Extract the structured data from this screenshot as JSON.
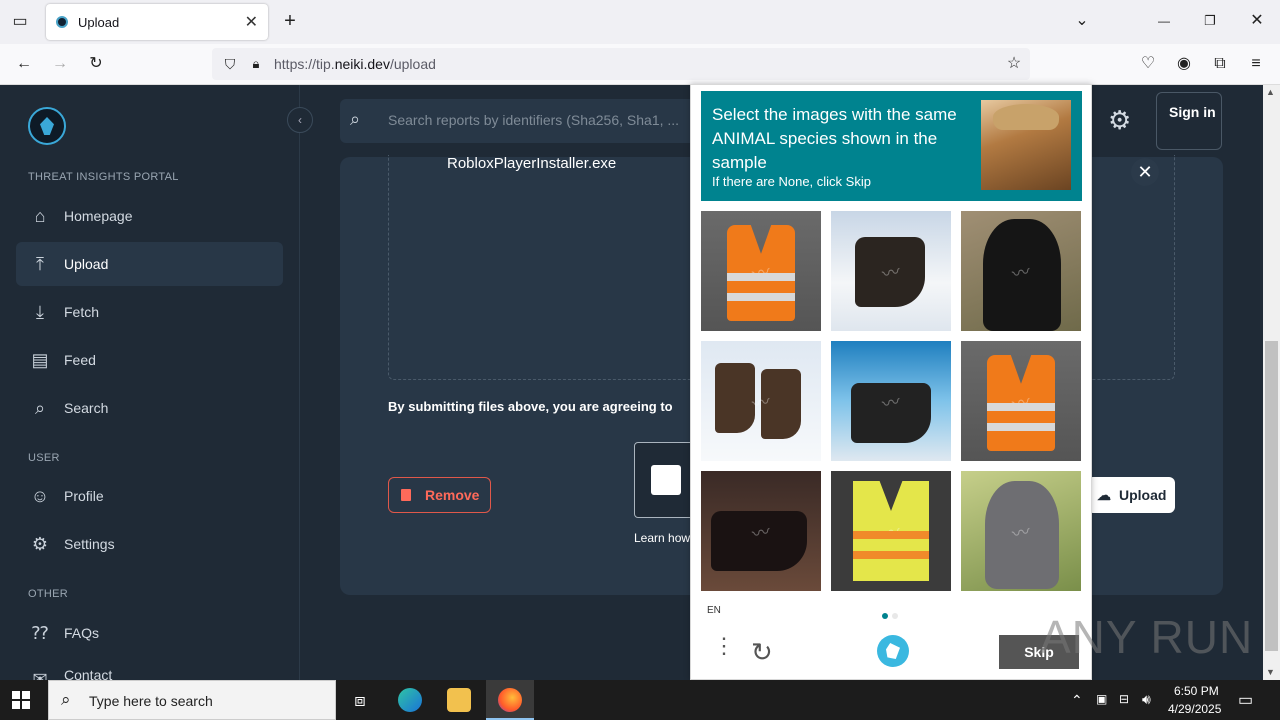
{
  "browser": {
    "tab_title": "Upload",
    "tab_close": "✕",
    "new_tab": "+",
    "url_prefix": "https://tip.",
    "url_domain": "neiki.dev",
    "url_path": "/upload",
    "window_controls": [
      "—",
      "❐",
      "✕"
    ]
  },
  "sidebar": {
    "section_portal": "THREAT INSIGHTS PORTAL",
    "items": [
      {
        "label": "Homepage",
        "icon": "home-icon"
      },
      {
        "label": "Upload",
        "icon": "upload-icon",
        "active": true
      },
      {
        "label": "Fetch",
        "icon": "fetch-icon"
      },
      {
        "label": "Feed",
        "icon": "feed-icon"
      },
      {
        "label": "Search",
        "icon": "search-icon"
      }
    ],
    "section_user": "USER",
    "user_items": [
      {
        "label": "Profile",
        "icon": "profile-icon"
      },
      {
        "label": "Settings",
        "icon": "gear-icon"
      }
    ],
    "section_other": "OTHER",
    "other_items": [
      {
        "label": "FAQs",
        "icon": "faq-icon"
      },
      {
        "label": "Contact",
        "icon": "contact-icon"
      }
    ]
  },
  "header": {
    "search_placeholder": "Search reports by identifiers (Sha256, Sha1, ...",
    "sign_in": "Sign in"
  },
  "upload": {
    "file_name": "RobloxPlayerInstaller.exe",
    "terms_text": "By submitting files above, you are agreeing to",
    "remove_label": "Remove",
    "learn_text": "Learn how",
    "upload_label": "Upload"
  },
  "captcha": {
    "prompt": "Select the images with the same ANIMAL species shown in the sample",
    "sub": "If there are None, click Skip",
    "language": "EN",
    "skip_label": "Skip",
    "tiles": [
      "vest",
      "boot",
      "dog",
      "boots",
      "boot",
      "vest",
      "boot",
      "vest",
      "dog"
    ]
  },
  "watermark": "ANY RUN",
  "taskbar": {
    "search_placeholder": "Type here to search",
    "time": "6:50 PM",
    "date": "4/29/2025"
  },
  "colors": {
    "captcha_header": "#00838f",
    "sidebar_bg": "#1f2a36",
    "remove_red": "#ff6a5a"
  }
}
